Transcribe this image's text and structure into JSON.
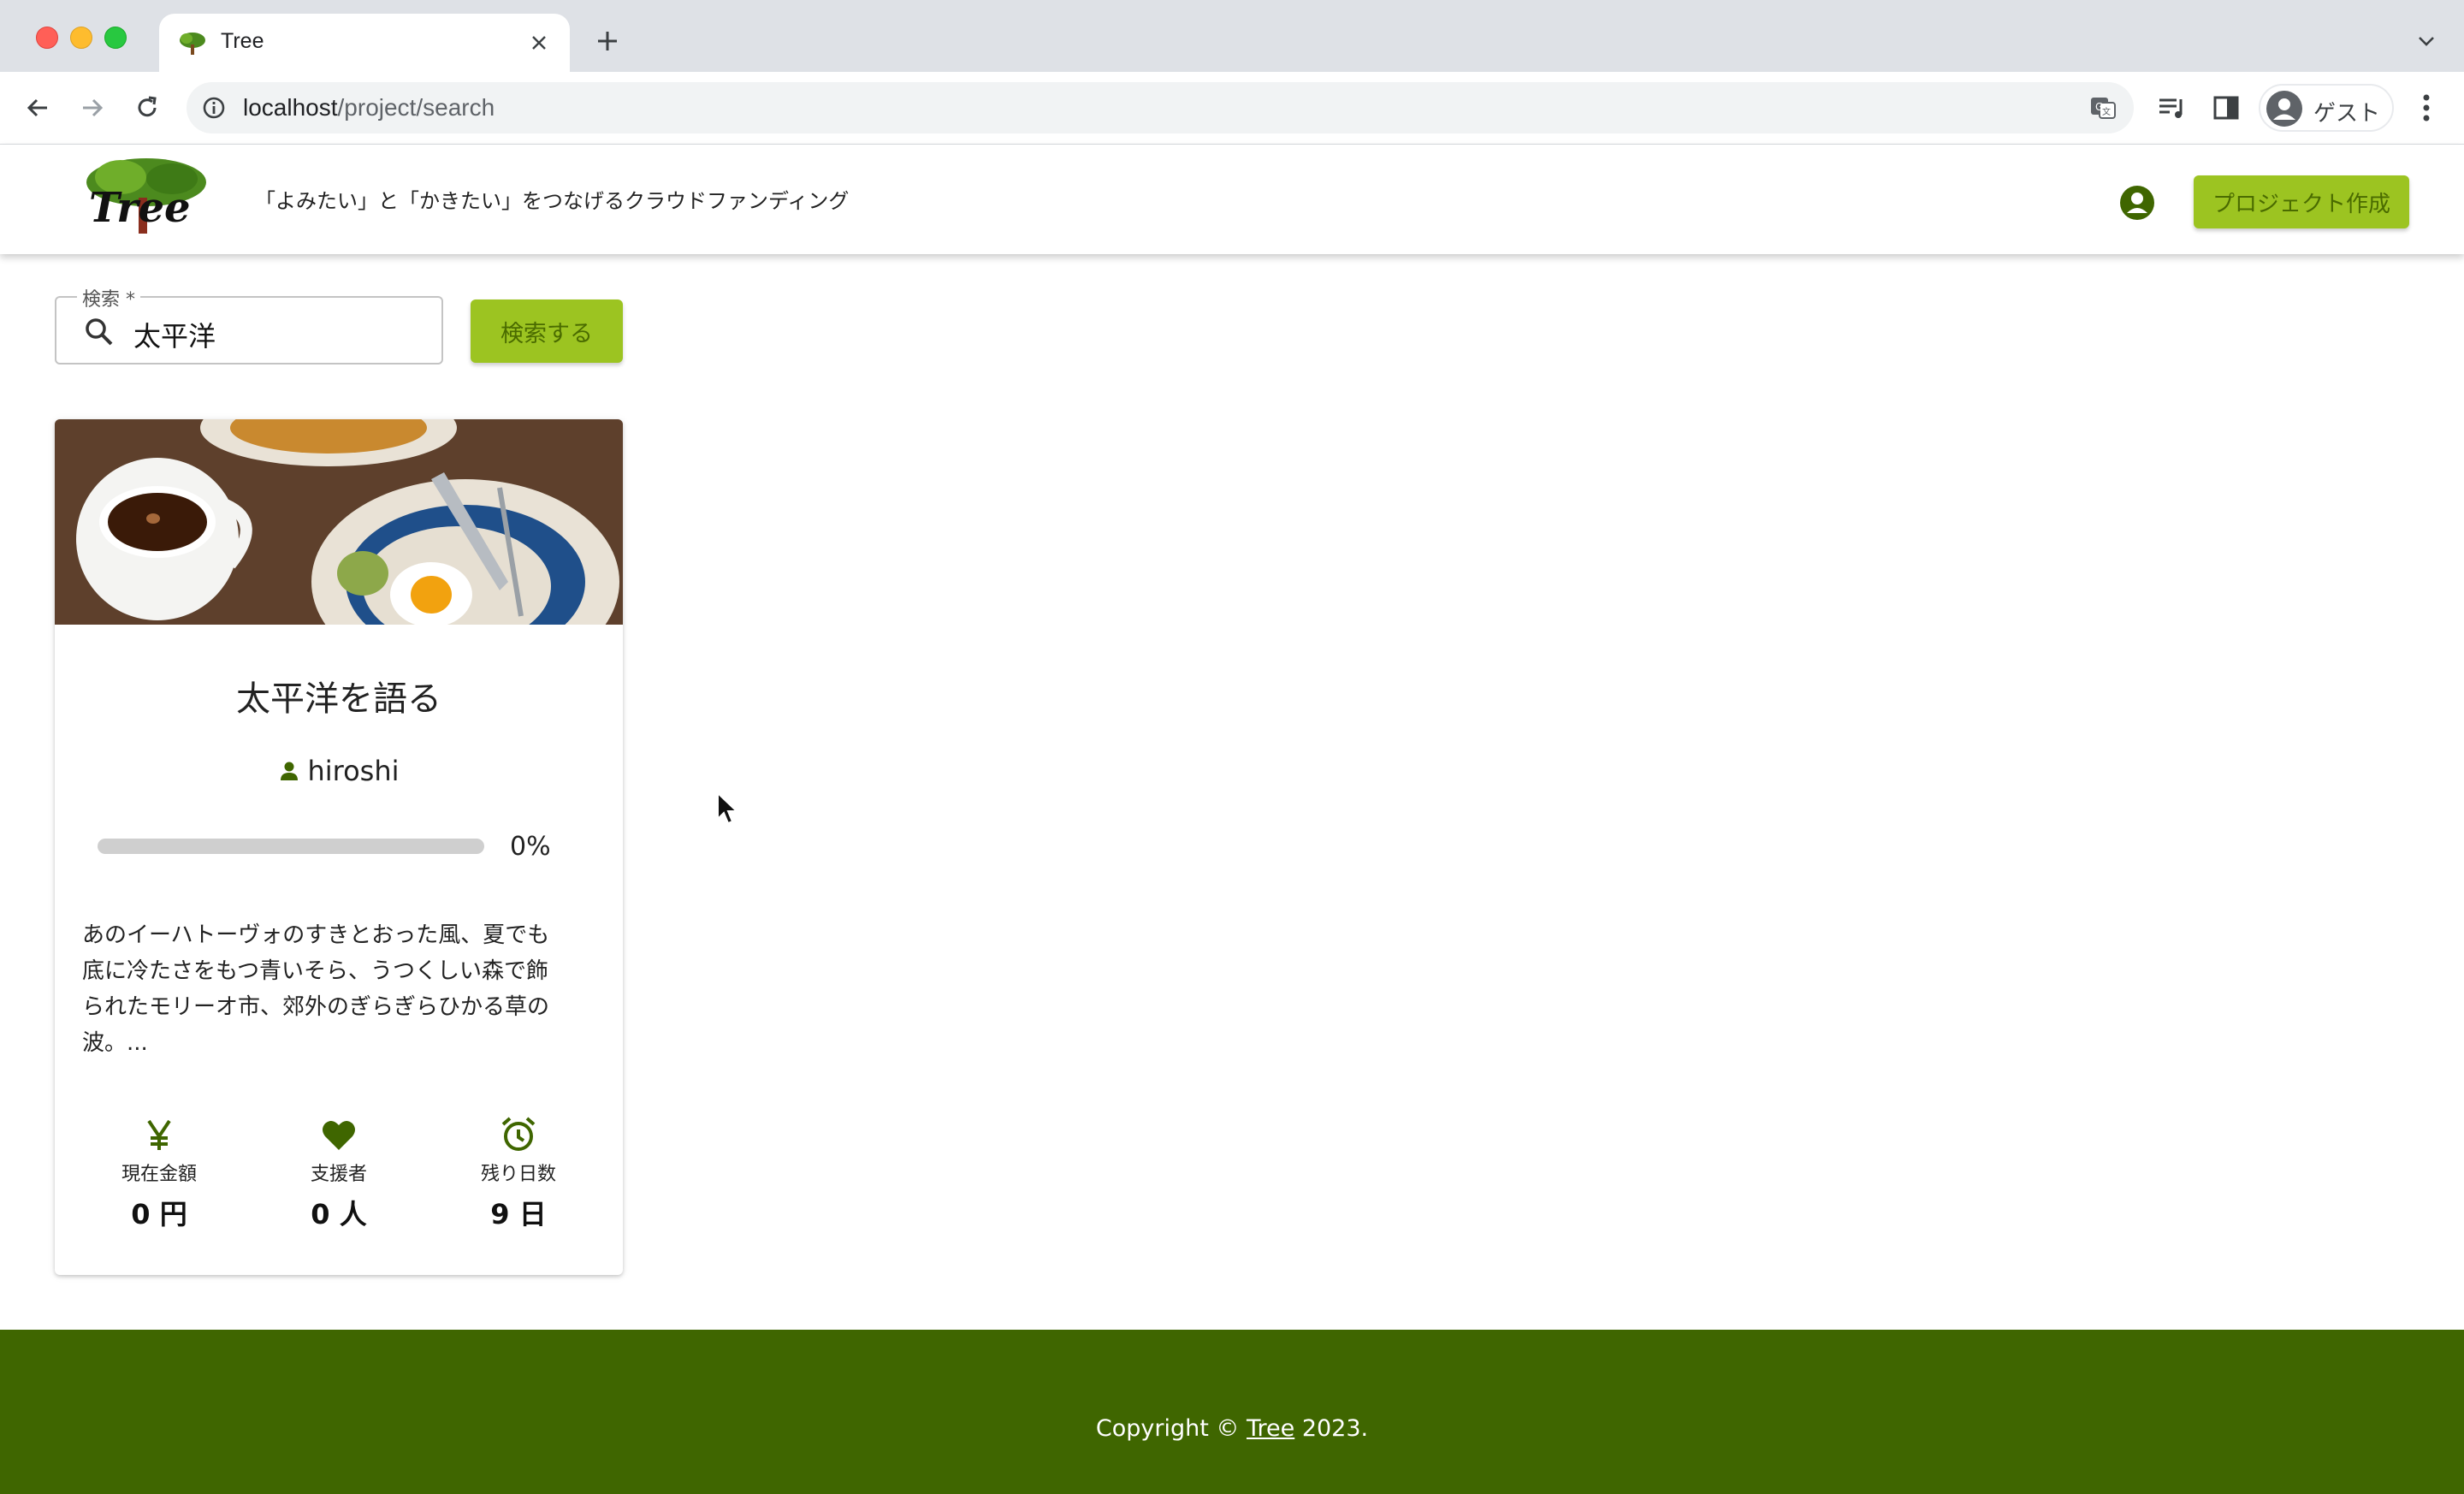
{
  "browser": {
    "tab_title": "Tree",
    "url_host": "localhost",
    "url_path": "/project/search",
    "profile_label": "ゲスト"
  },
  "header": {
    "logo_text": "Tree",
    "tagline": "「よみたい」と「かきたい」をつなげるクラウドファンディング",
    "create_button": "プロジェクト作成"
  },
  "search": {
    "legend": "検索 *",
    "value": "太平洋",
    "button": "検索する"
  },
  "project": {
    "title": "太平洋を語る",
    "author": "hiroshi",
    "progress_percent": 0,
    "progress_label": "0%",
    "description": "あのイーハトーヴォのすきとおった風、夏でも\n底に冷たさをもつ青いそら、うつくしい森で飾\nられたモリーオ市、郊外のぎらぎらひかる草の\n波。...",
    "stats": [
      {
        "icon": "yen-icon",
        "label": "現在金額",
        "value": "0 円"
      },
      {
        "icon": "heart-icon",
        "label": "支援者",
        "value": "0 人"
      },
      {
        "icon": "alarm-clock-icon",
        "label": "残り日数",
        "value": "9 日"
      }
    ]
  },
  "footer": {
    "prefix": "Copyright © ",
    "link": "Tree",
    "suffix": " 2023."
  },
  "colors": {
    "accent_green": "#9cc421",
    "dark_green": "#3f6600"
  }
}
